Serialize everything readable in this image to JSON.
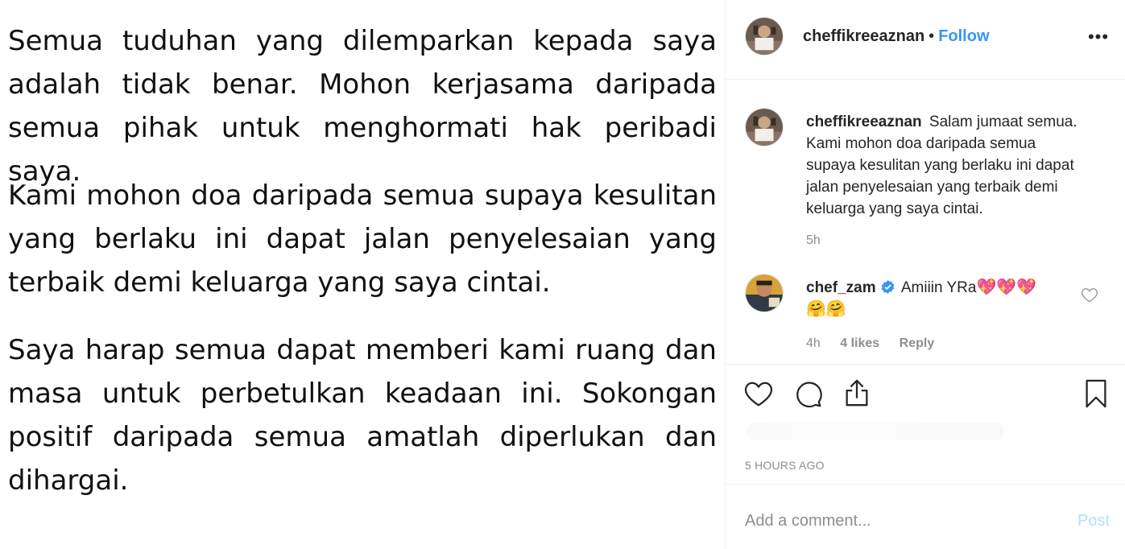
{
  "post_image": {
    "paragraphs": [
      "Semua tuduhan yang dilemparkan kepada saya adalah tidak benar.  Mohon kerjasama daripada semua pihak untuk menghormati hak peribadi saya.",
      "Kami mohon doa daripada semua supaya kesulitan yang berlaku ini dapat jalan penyelesaian yang terbaik demi keluarga yang saya cintai.",
      "Saya harap semua dapat memberi kami ruang dan masa untuk perbetulkan keadaan ini. Sokongan positif daripada semua amatlah diperlukan dan dihargai."
    ]
  },
  "header": {
    "username": "cheffikreeaznan",
    "separator": "•",
    "follow_label": "Follow",
    "more_icon": "more-options-icon"
  },
  "caption": {
    "username": "cheffikreeaznan",
    "text": "Salam jumaat semua. Kami mohon doa daripada semua supaya kesulitan yang berlaku ini dapat jalan penyelesaian yang terbaik demi keluarga yang saya cintai.",
    "time": "5h"
  },
  "comments": [
    {
      "username": "chef_zam",
      "verified": true,
      "text": "Amiiin YRa",
      "emojis_line1": "💖💖💖",
      "emojis_line2": "🤗🤗",
      "time": "4h",
      "likes": "4 likes",
      "reply_label": "Reply"
    }
  ],
  "actions": {
    "like_icon": "heart-icon",
    "comment_icon": "comment-icon",
    "share_icon": "share-icon",
    "save_icon": "bookmark-icon"
  },
  "post_time": "5 HOURS AGO",
  "add_comment": {
    "placeholder": "Add a comment...",
    "post_label": "Post"
  },
  "colors": {
    "link_blue": "#3897f0",
    "post_disabled": "#b2dffc",
    "muted": "#8e8e8e",
    "text": "#262626",
    "border": "#efefef"
  }
}
